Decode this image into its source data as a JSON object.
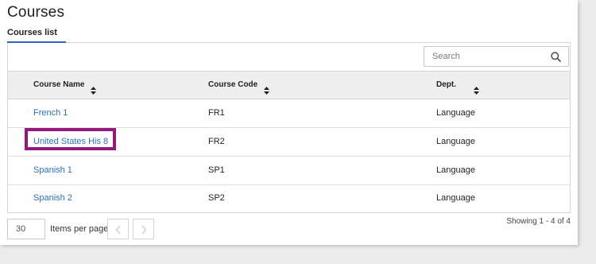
{
  "page": {
    "title": "Courses"
  },
  "tabs": [
    {
      "label": "Courses list",
      "active": true
    }
  ],
  "search": {
    "placeholder": "Search",
    "icon": "search-icon"
  },
  "table": {
    "columns": [
      {
        "label": "Course Name",
        "sortable": true
      },
      {
        "label": "Course Code",
        "sortable": true
      },
      {
        "label": "Dept.",
        "sortable": true
      }
    ],
    "rows": [
      {
        "name": "French 1",
        "code": "FR1",
        "dept": "Language"
      },
      {
        "name": "United States His 8",
        "code": "FR2",
        "dept": "Language",
        "highlighted": true
      },
      {
        "name": "Spanish 1",
        "code": "SP1",
        "dept": "Language"
      },
      {
        "name": "Spanish 2",
        "code": "SP2",
        "dept": "Language"
      }
    ]
  },
  "pagination": {
    "items_per_page": "30",
    "items_per_page_label": "Items per page",
    "prev_icon": "chevron-left-icon",
    "next_icon": "chevron-right-icon",
    "showing": "Showing 1 - 4 of 4"
  },
  "colors": {
    "link": "#2a6fc9",
    "highlight": "#94197d",
    "tab_accent": "#2a66c9",
    "header_bg": "#eeeeee"
  }
}
